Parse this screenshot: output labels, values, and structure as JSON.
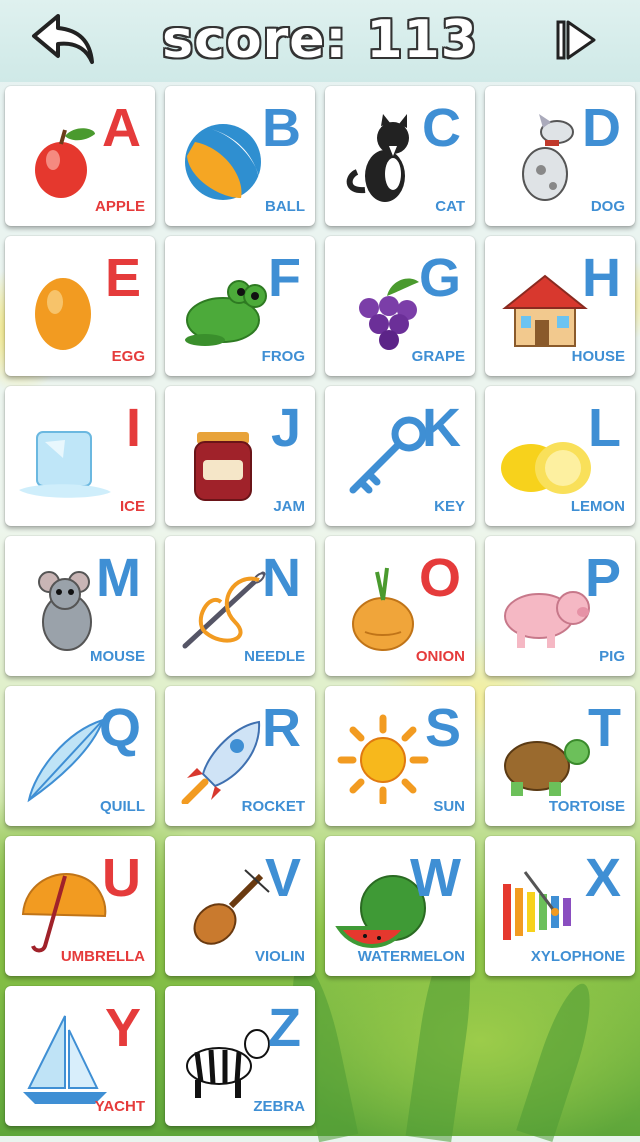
{
  "header": {
    "score_text": "score: 113",
    "back_icon": "back-arrow-icon",
    "next_icon": "skip-forward-icon"
  },
  "colors": {
    "vowel": "#e53b3b",
    "consonant": "#3f8fd4",
    "card": "#ffffff"
  },
  "cards": [
    {
      "letter": "A",
      "word": "APPLE",
      "icon": "apple-icon",
      "color": "red"
    },
    {
      "letter": "B",
      "word": "BALL",
      "icon": "ball-icon",
      "color": "blue"
    },
    {
      "letter": "C",
      "word": "CAT",
      "icon": "cat-icon",
      "color": "blue"
    },
    {
      "letter": "D",
      "word": "DOG",
      "icon": "dog-icon",
      "color": "blue"
    },
    {
      "letter": "E",
      "word": "EGG",
      "icon": "egg-icon",
      "color": "red"
    },
    {
      "letter": "F",
      "word": "FROG",
      "icon": "frog-icon",
      "color": "blue"
    },
    {
      "letter": "G",
      "word": "GRAPE",
      "icon": "grape-icon",
      "color": "blue"
    },
    {
      "letter": "H",
      "word": "HOUSE",
      "icon": "house-icon",
      "color": "blue"
    },
    {
      "letter": "I",
      "word": "ICE",
      "icon": "ice-icon",
      "color": "red"
    },
    {
      "letter": "J",
      "word": "JAM",
      "icon": "jam-icon",
      "color": "blue"
    },
    {
      "letter": "K",
      "word": "KEY",
      "icon": "key-icon",
      "color": "blue"
    },
    {
      "letter": "L",
      "word": "LEMON",
      "icon": "lemon-icon",
      "color": "blue"
    },
    {
      "letter": "M",
      "word": "MOUSE",
      "icon": "mouse-icon",
      "color": "blue"
    },
    {
      "letter": "N",
      "word": "NEEDLE",
      "icon": "needle-icon",
      "color": "blue"
    },
    {
      "letter": "O",
      "word": "ONION",
      "icon": "onion-icon",
      "color": "red"
    },
    {
      "letter": "P",
      "word": "PIG",
      "icon": "pig-icon",
      "color": "blue"
    },
    {
      "letter": "Q",
      "word": "QUILL",
      "icon": "quill-icon",
      "color": "blue"
    },
    {
      "letter": "R",
      "word": "ROCKET",
      "icon": "rocket-icon",
      "color": "blue"
    },
    {
      "letter": "S",
      "word": "SUN",
      "icon": "sun-icon",
      "color": "blue"
    },
    {
      "letter": "T",
      "word": "TORTOISE",
      "icon": "tortoise-icon",
      "color": "blue"
    },
    {
      "letter": "U",
      "word": "UMBRELLA",
      "icon": "umbrella-icon",
      "color": "red"
    },
    {
      "letter": "V",
      "word": "VIOLIN",
      "icon": "violin-icon",
      "color": "blue"
    },
    {
      "letter": "W",
      "word": "WATERMELON",
      "icon": "watermelon-icon",
      "color": "blue"
    },
    {
      "letter": "X",
      "word": "XYLOPHONE",
      "icon": "xylophone-icon",
      "color": "blue"
    },
    {
      "letter": "Y",
      "word": "YACHT",
      "icon": "yacht-icon",
      "color": "red"
    },
    {
      "letter": "Z",
      "word": "ZEBRA",
      "icon": "zebra-icon",
      "color": "blue"
    }
  ]
}
